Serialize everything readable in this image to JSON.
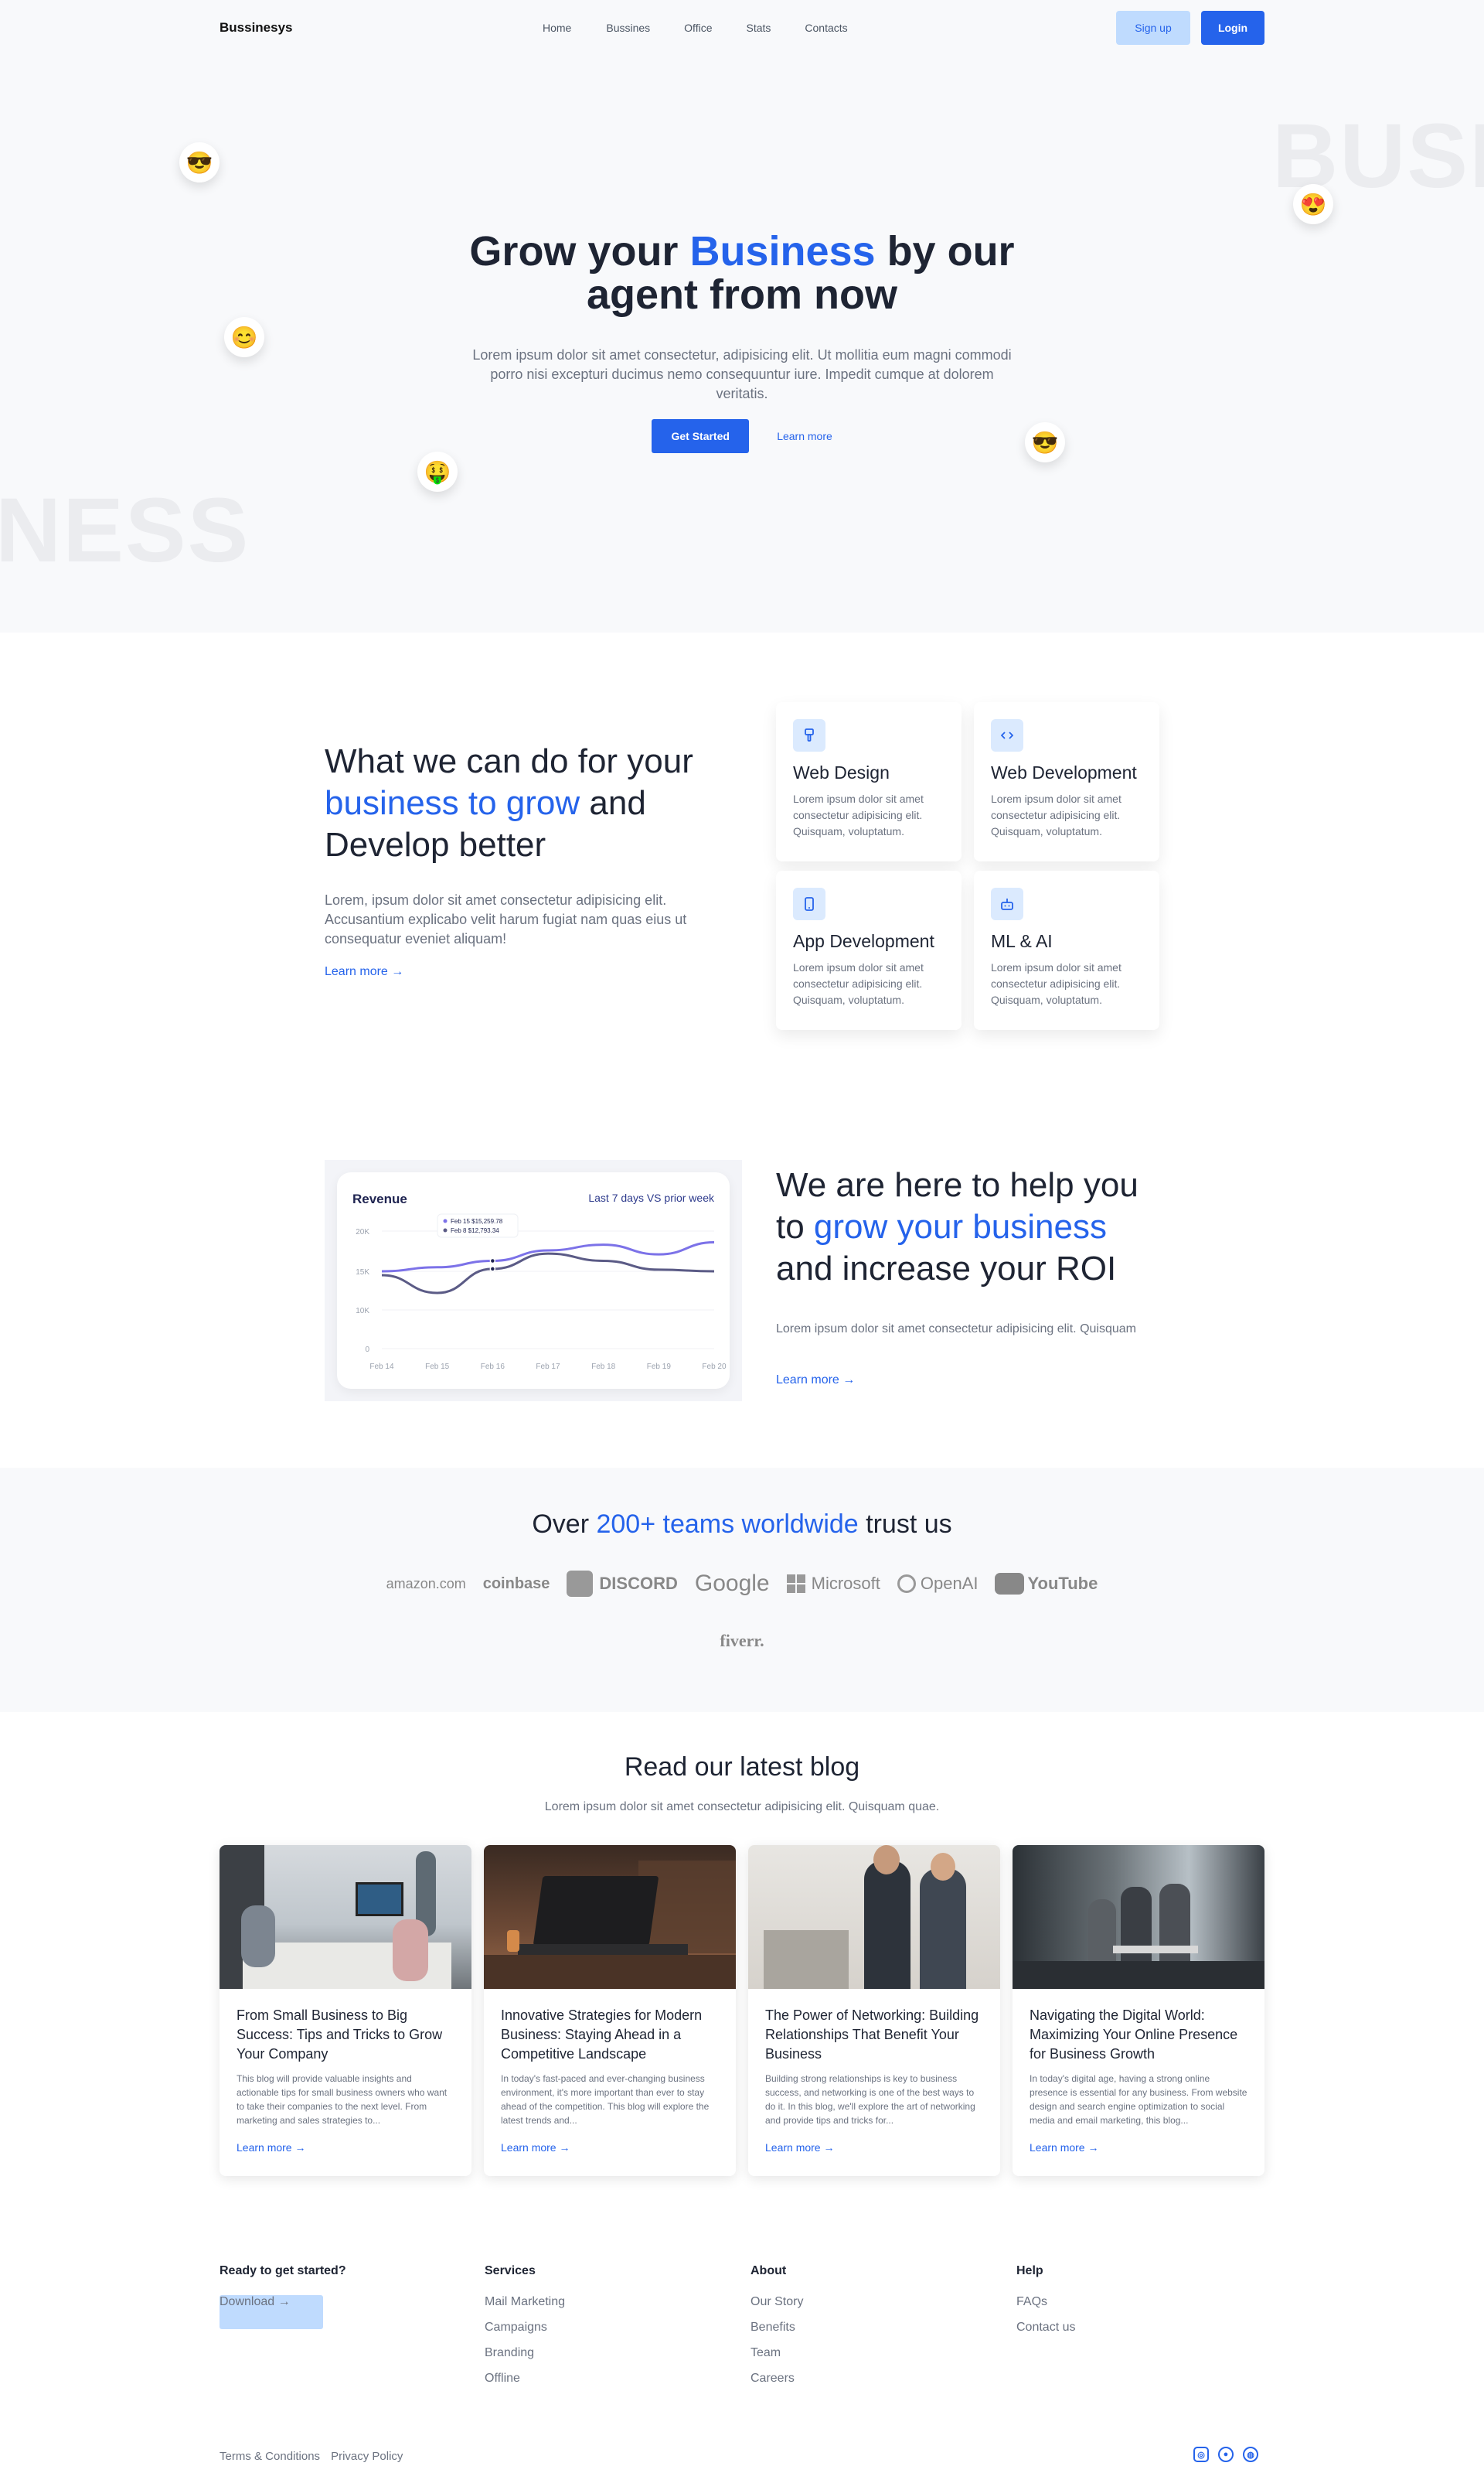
{
  "nav": {
    "brand": "Bussinesys",
    "items": [
      "Home",
      "Bussines",
      "Office",
      "Stats",
      "Contacts"
    ],
    "signup": "Sign up",
    "login": "Login"
  },
  "hero": {
    "bg_word_1": "BUSI",
    "bg_word_2": "NESS",
    "title_pre": "Grow your ",
    "title_accent": "Business",
    "title_post": " by our",
    "title_line2": "agent from now",
    "description": "Lorem ipsum dolor sit amet consectetur, adipisicing elit. Ut mollitia eum magni commodi porro nisi excepturi ducimus nemo consequuntur iure. Impedit cumque at dolorem veritatis.",
    "cta_primary": "Get Started",
    "cta_secondary": "Learn more",
    "emojis": [
      "😎",
      "😊",
      "🤑",
      "😍",
      "😎"
    ]
  },
  "services": {
    "title_line1": "What we can do for your",
    "title_accent": "business to grow",
    "title_mid": " and",
    "title_line3": "Develop better",
    "description": "Lorem, ipsum dolor sit amet consectetur adipisicing elit. Accusantium explicabo velit harum fugiat nam quas eius ut consequatur eveniet aliquam!",
    "link": "Learn more →",
    "cards": [
      {
        "title": "Web Design",
        "text": "Lorem ipsum dolor sit amet consectetur adipisicing elit. Quisquam, voluptatum.",
        "icon": "brush-icon"
      },
      {
        "title": "Web Development",
        "text": "Lorem ipsum dolor sit amet consectetur adipisicing elit. Quisquam, voluptatum.",
        "icon": "code-icon"
      },
      {
        "title": "App Development",
        "text": "Lorem ipsum dolor sit amet consectetur adipisicing elit. Quisquam, voluptatum.",
        "icon": "phone-icon"
      },
      {
        "title": "ML & AI",
        "text": "Lorem ipsum dolor sit amet consectetur adipisicing elit. Quisquam, voluptatum.",
        "icon": "robot-icon"
      }
    ]
  },
  "roi": {
    "title_line1": "We are here to help you",
    "title_pre2": "to ",
    "title_accent": "grow your business",
    "title_line3": "and increase your ROI",
    "description": "Lorem ipsum dolor sit amet consectetur adipisicing elit. Quisquam",
    "link": "Learn more →"
  },
  "chart_data": {
    "type": "line",
    "title": "Revenue",
    "subtitle": "Last 7 days VS prior week",
    "categories": [
      "Feb 14",
      "Feb 15",
      "Feb 16",
      "Feb 17",
      "Feb 18",
      "Feb 19",
      "Feb 20"
    ],
    "y_ticks": [
      "0",
      "10K",
      "15K",
      "20K"
    ],
    "ylim": [
      0,
      20
    ],
    "series": [
      {
        "values": [
          15,
          15.5,
          16.3,
          17.6,
          18.3,
          17.1,
          18.6
        ],
        "color": "#7c72e8"
      },
      {
        "values": [
          14.5,
          12.2,
          15.3,
          17.2,
          16.3,
          15.2,
          15.0
        ],
        "color": "#5b5b86"
      }
    ],
    "tooltip": {
      "line1": "Feb 15 $15,259.78",
      "line2": "Feb 8 $12,793.34"
    }
  },
  "trust": {
    "title_pre": "Over ",
    "title_accent": "200+ teams worldwide",
    "title_post": " trust us",
    "logos": [
      "amazon.com",
      "coinbase",
      "DISCORD",
      "Google",
      "Microsoft",
      "OpenAI",
      "YouTube",
      "fiverr."
    ]
  },
  "blog": {
    "title": "Read our latest blog",
    "subtitle": "Lorem ipsum dolor sit amet consectetur adipisicing elit. Quisquam quae.",
    "posts": [
      {
        "title": "From Small Business to Big Success: Tips and Tricks to Grow Your Company",
        "excerpt": "This blog will provide valuable insights and actionable tips for small business owners who want to take their companies to the next level. From marketing and sales strategies to...",
        "link": "Learn more →"
      },
      {
        "title": "Innovative Strategies for Modern Business: Staying Ahead in a Competitive Landscape",
        "excerpt": "In today's fast-paced and ever-changing business environment, it's more important than ever to stay ahead of the competition. This blog will explore the latest trends and...",
        "link": "Learn more →"
      },
      {
        "title": "The Power of Networking: Building Relationships That Benefit Your Business",
        "excerpt": "Building strong relationships is key to business success, and networking is one of the best ways to do it. In this blog, we'll explore the art of networking and provide tips and tricks for...",
        "link": "Learn more →"
      },
      {
        "title": "Navigating the Digital World: Maximizing Your Online Presence for Business Growth",
        "excerpt": "In today's digital age, having a strong online presence is essential for any business. From website design and search engine optimization to social media and email marketing, this blog...",
        "link": "Learn more →"
      }
    ]
  },
  "footer": {
    "cta_title": "Ready to get started?",
    "download": "Download →",
    "services": {
      "title": "Services",
      "links": [
        "Mail Marketing",
        "Campaigns",
        "Branding",
        "Offline"
      ]
    },
    "about": {
      "title": "About",
      "links": [
        "Our Story",
        "Benefits",
        "Team",
        "Careers"
      ]
    },
    "help": {
      "title": "Help",
      "links": [
        "FAQs",
        "Contact us"
      ]
    },
    "terms": "Terms & Conditions",
    "privacy": "Privacy Policy",
    "social": [
      "instagram-icon",
      "github-icon",
      "dribbble-icon"
    ]
  }
}
